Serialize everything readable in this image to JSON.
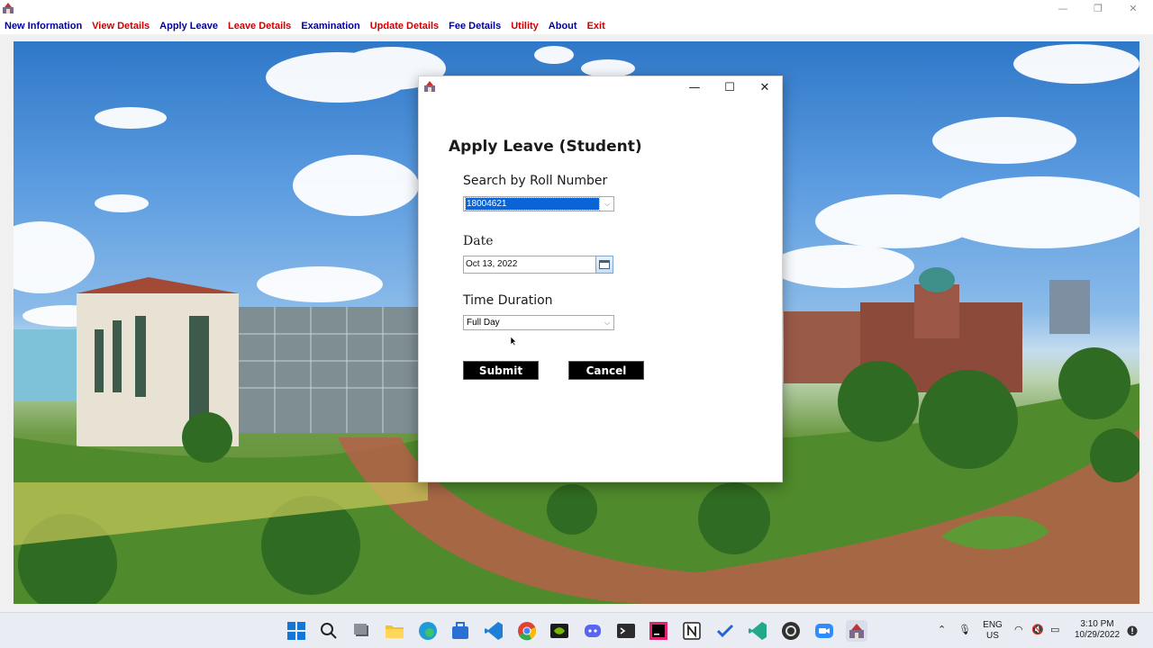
{
  "menu": {
    "items": [
      {
        "label": "New Information",
        "color": "#0000a0"
      },
      {
        "label": "View Details",
        "color": "#d00000"
      },
      {
        "label": "Apply Leave",
        "color": "#0000a0"
      },
      {
        "label": "Leave Details",
        "color": "#d00000"
      },
      {
        "label": "Examination",
        "color": "#0000a0"
      },
      {
        "label": "Update Details",
        "color": "#d00000"
      },
      {
        "label": "Fee Details",
        "color": "#0000a0"
      },
      {
        "label": "Utility",
        "color": "#d00000"
      },
      {
        "label": "About",
        "color": "#0000a0"
      },
      {
        "label": "Exit",
        "color": "#d00000"
      }
    ]
  },
  "window_controls": {
    "minimize": "—",
    "maximize": "❐",
    "close": "✕"
  },
  "dialog": {
    "controls": {
      "minimize": "—",
      "maximize": "☐",
      "close": "✕"
    },
    "heading": "Apply Leave (Student)",
    "roll": {
      "label": "Search by Roll Number",
      "value": "18004621"
    },
    "date": {
      "label": "Date",
      "value": "Oct 13, 2022"
    },
    "duration": {
      "label": "Time Duration",
      "value": "Full Day"
    },
    "submit_label": "Submit",
    "cancel_label": "Cancel"
  },
  "taskbar": {
    "icons": [
      "windows-start-icon",
      "search-icon",
      "task-view-icon",
      "file-explorer-icon",
      "edge-icon",
      "store-icon",
      "vscode-icon",
      "chrome-icon",
      "nvidia-icon",
      "discord-icon",
      "terminal-icon",
      "intellij-icon",
      "notion-icon",
      "todo-icon",
      "vscode-insiders-icon",
      "obs-icon",
      "zoom-icon",
      "java-app-icon"
    ],
    "tray": {
      "language_top": "ENG",
      "language_bottom": "US",
      "time": "3:10 PM",
      "date": "10/29/2022"
    }
  },
  "colors": {
    "menu_blue": "#0000a0",
    "menu_red": "#d00000",
    "selection": "#0a64d8"
  }
}
